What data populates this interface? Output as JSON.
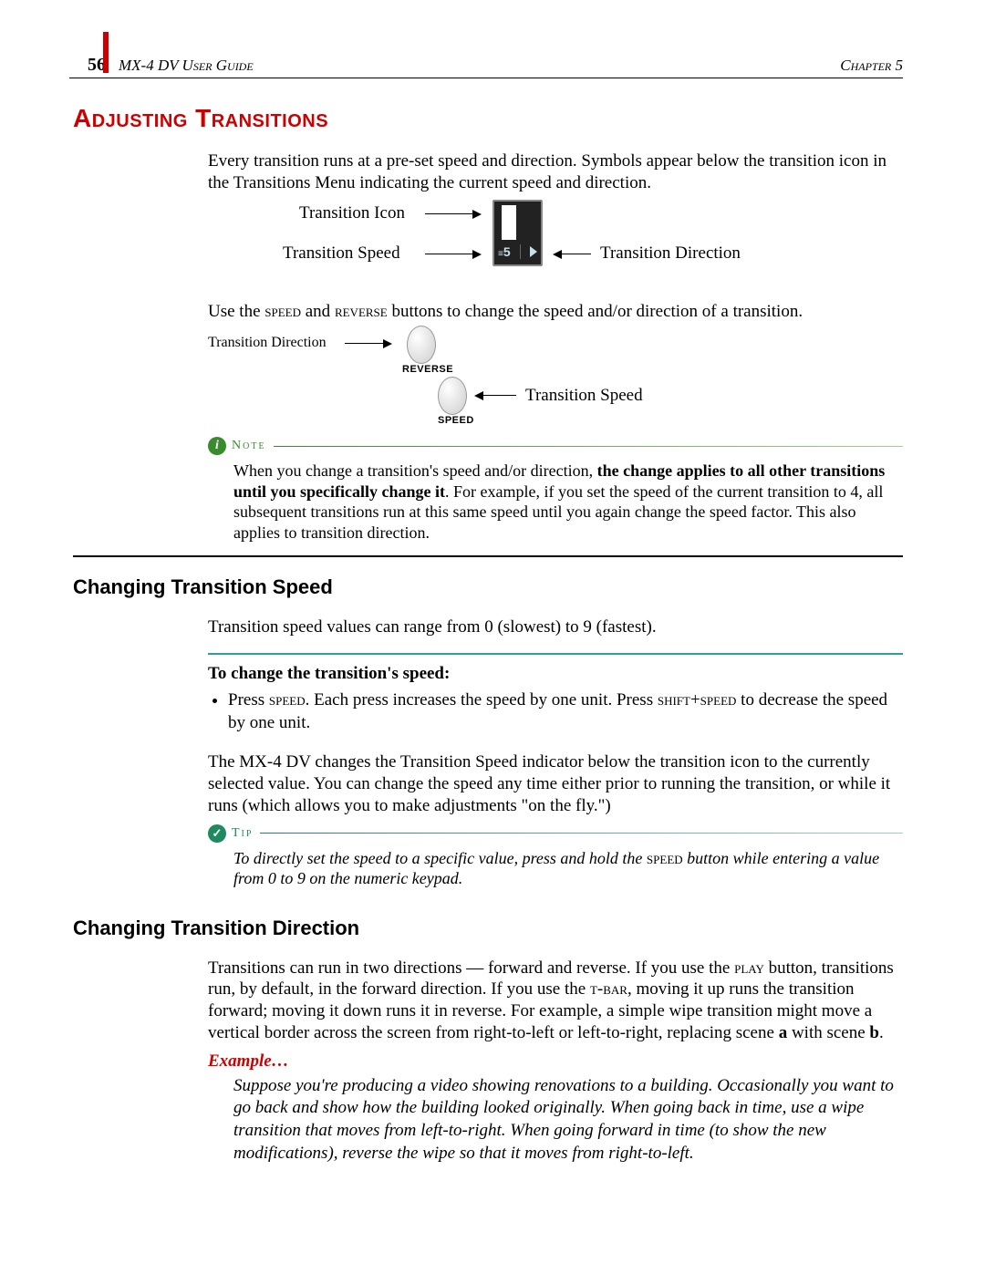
{
  "header": {
    "page_number": "56",
    "guide": "MX-4 DV User Guide",
    "chapter": "Chapter 5"
  },
  "section_title": "Adjusting Transitions",
  "intro_p1": "Every transition runs at a pre-set speed and direction. Symbols appear below the transition icon in the Transitions Menu indicating the current speed and direction.",
  "diagram1": {
    "label_icon": "Transition Icon",
    "label_speed": "Transition Speed",
    "label_direction": "Transition Direction",
    "speed_value": "5"
  },
  "use_line": {
    "pre": "Use the ",
    "k1": "speed",
    "mid": " and ",
    "k2": "reverse",
    "post": " buttons to change the speed and/or direction of a transition."
  },
  "diagram2": {
    "label_direction": "Transition Direction",
    "label_speed": "Transition Speed",
    "btn_reverse": "REVERSE",
    "btn_speed": "SPEED"
  },
  "note": {
    "label": "Note",
    "body_pre": "When you change a transition's speed and/or direction, ",
    "body_bold": "the change applies to all other transitions until you specifically change it",
    "body_post": ". For example, if you set the speed of the current transition to 4, all subsequent transitions run at this same speed until you again change the speed factor. This also applies to transition direction."
  },
  "speed_section": {
    "heading": "Changing Transition Speed",
    "p1": "Transition speed values can range from 0 (slowest) to 9 (fastest).",
    "instr_head": "To change the transition's speed:",
    "bullet": {
      "pre": "Press ",
      "k1": "speed",
      "mid1": ". Each press increases the speed by one unit. Press ",
      "k2": "shift+speed",
      "post": " to decrease the speed by one unit."
    },
    "p2": "The MX-4 DV changes the Transition Speed indicator below the transition icon to the currently selected value. You can change the speed any time either prior to running the transition, or while it runs (which allows you to make adjustments \"on the fly.\")"
  },
  "tip": {
    "label": "Tip",
    "body_pre": "To directly set the speed to a specific value, press and hold the ",
    "key": "speed",
    "body_post": " button while entering a value from 0 to 9 on the numeric keypad."
  },
  "direction_section": {
    "heading": "Changing Transition Direction",
    "p1": {
      "t1": "Transitions can run in two directions — forward and reverse. If you use the ",
      "k1": "play",
      "t2": " button, transitions run, by default, in the forward direction. If you use the ",
      "k2": "t-bar",
      "t3": ", moving it up runs the transition forward; moving it down runs it in reverse. For example, a simple wipe transition might move a vertical border across the screen from right-to-left or left-to-right, replacing scene ",
      "a": "a",
      "t4": " with scene ",
      "b": "b",
      "t5": "."
    },
    "example_label": "Example…",
    "example_body": "Suppose you're producing a video showing renovations to a building. Occasionally you want to go back and show how the building looked originally. When going back in time, use a wipe transition that moves from left-to-right. When going forward in time (to show the new modifications), reverse the wipe so that it moves from right-to-left."
  }
}
